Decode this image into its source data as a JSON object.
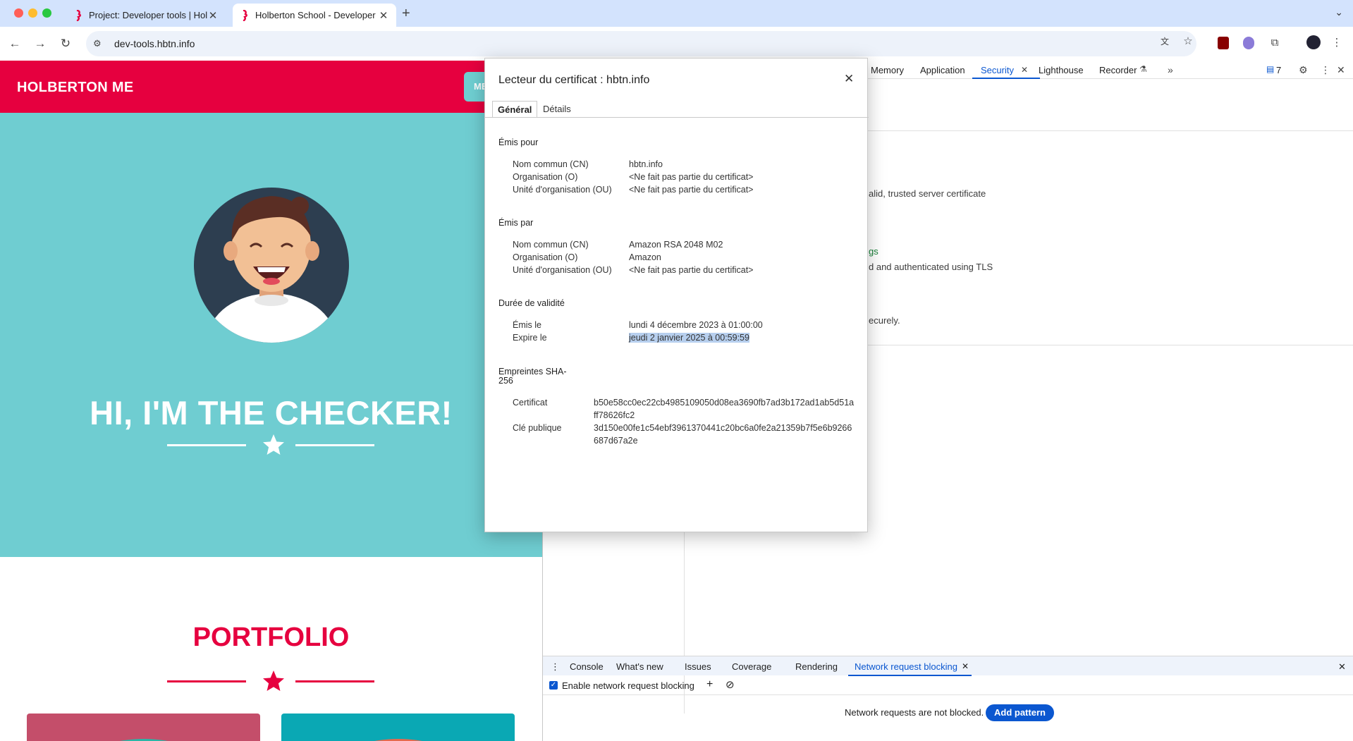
{
  "browser": {
    "tabs": [
      {
        "title": "Project: Developer tools | Holberton",
        "active": false
      },
      {
        "title": "Holberton School - Developer tools",
        "active": true
      }
    ],
    "url": "dev-tools.hbtn.info"
  },
  "site": {
    "logo": "HOLBERTON ME",
    "menu_button": "ME",
    "hero_title": "HI, I'M THE CHECKER!",
    "portfolio_title": "PORTFOLIO",
    "colors": {
      "brand_red": "#e6003f",
      "hero_teal": "#6fcdd1"
    }
  },
  "devtools": {
    "tabs": [
      "Memory",
      "Application",
      "Security",
      "Lighthouse",
      "Recorder"
    ],
    "selected_tab": "Security",
    "issues_count": "7",
    "security_fragments": [
      "alid, trusted server certificate",
      "gs",
      "d and authenticated using TLS",
      "ecurely."
    ],
    "drawer": {
      "tabs": [
        "Console",
        "What's new",
        "Issues",
        "Coverage",
        "Rendering",
        "Network request blocking"
      ],
      "selected_tab": "Network request blocking",
      "enable_label": "Enable network request blocking",
      "empty_message": "Network requests are not blocked.",
      "add_pattern": "Add pattern"
    }
  },
  "certificate": {
    "title": "Lecteur du certificat : hbtn.info",
    "tabs": [
      "Général",
      "Détails"
    ],
    "issued_to": {
      "heading": "Émis pour",
      "rows": [
        {
          "key": "Nom commun (CN)",
          "value": "hbtn.info"
        },
        {
          "key": "Organisation (O)",
          "value": "<Ne fait pas partie du certificat>"
        },
        {
          "key": "Unité d'organisation (OU)",
          "value": "<Ne fait pas partie du certificat>"
        }
      ]
    },
    "issued_by": {
      "heading": "Émis par",
      "rows": [
        {
          "key": "Nom commun (CN)",
          "value": "Amazon RSA 2048 M02"
        },
        {
          "key": "Organisation (O)",
          "value": "Amazon"
        },
        {
          "key": "Unité d'organisation (OU)",
          "value": "<Ne fait pas partie du certificat>"
        }
      ]
    },
    "validity": {
      "heading": "Durée de validité",
      "rows": [
        {
          "key": "Émis le",
          "value": "lundi 4 décembre 2023 à 01:00:00"
        },
        {
          "key": "Expire le",
          "value": "jeudi 2 janvier 2025 à 00:59:59"
        }
      ]
    },
    "fingerprints": {
      "heading_line1": "Empreintes SHA-",
      "heading_line2": "256",
      "rows": [
        {
          "key": "Certificat",
          "value": "b50e58cc0ec22cb4985109050d08ea3690fb7ad3b172ad1ab5d51aff78626fc2"
        },
        {
          "key": "Clé publique",
          "value": "3d150e00fe1c54ebf3961370441c20bc6a0fe2a21359b7f5e6b9266687d67a2e"
        }
      ]
    }
  }
}
